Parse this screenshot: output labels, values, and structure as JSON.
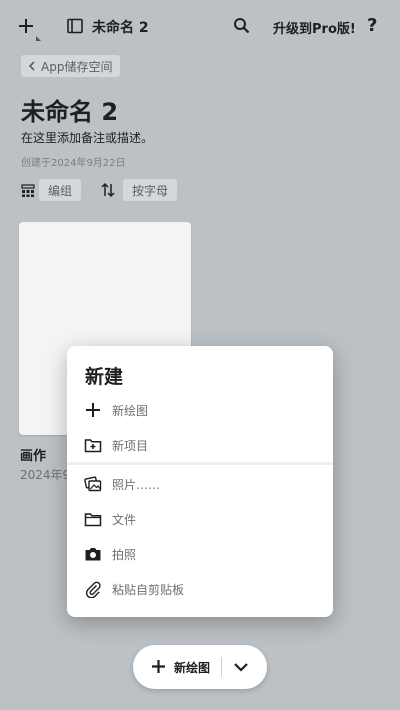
{
  "topbar": {
    "title": "未命名 2",
    "upgrade_label": "升级到Pro版!",
    "help_label": "?",
    "icons": [
      "add-icon",
      "sidebar-icon",
      "search-icon"
    ]
  },
  "breadcrumb": {
    "label": "App储存空间",
    "icon": "chevron-left-icon"
  },
  "page": {
    "title": "未命名 2",
    "description": "在这里添加备注或描述。",
    "created": "创建于2024年9月22日"
  },
  "toolbar": {
    "group_label": "编组",
    "sort_label": "按字母",
    "icons": [
      "grid-group-icon",
      "sort-icon"
    ]
  },
  "card": {
    "title": "画作",
    "date": "2024年9"
  },
  "popup": {
    "title": "新建",
    "items": [
      {
        "label": "新绘图",
        "icon": "plus-icon"
      },
      {
        "label": "新项目",
        "icon": "new-folder-icon"
      },
      {
        "label": "照片……",
        "icon": "photos-icon"
      },
      {
        "label": "文件",
        "icon": "folder-icon"
      },
      {
        "label": "拍照",
        "icon": "camera-icon"
      },
      {
        "label": "粘贴自剪贴板",
        "icon": "paperclip-icon"
      }
    ]
  },
  "fab": {
    "label": "新绘图",
    "icons": [
      "plus-icon",
      "chevron-down-icon"
    ]
  },
  "colors": {
    "background": "#bcc1c5",
    "surface": "#ffffff",
    "chip": "#d4d8db",
    "text": "#1e1f22",
    "muted": "#6b6f75"
  }
}
